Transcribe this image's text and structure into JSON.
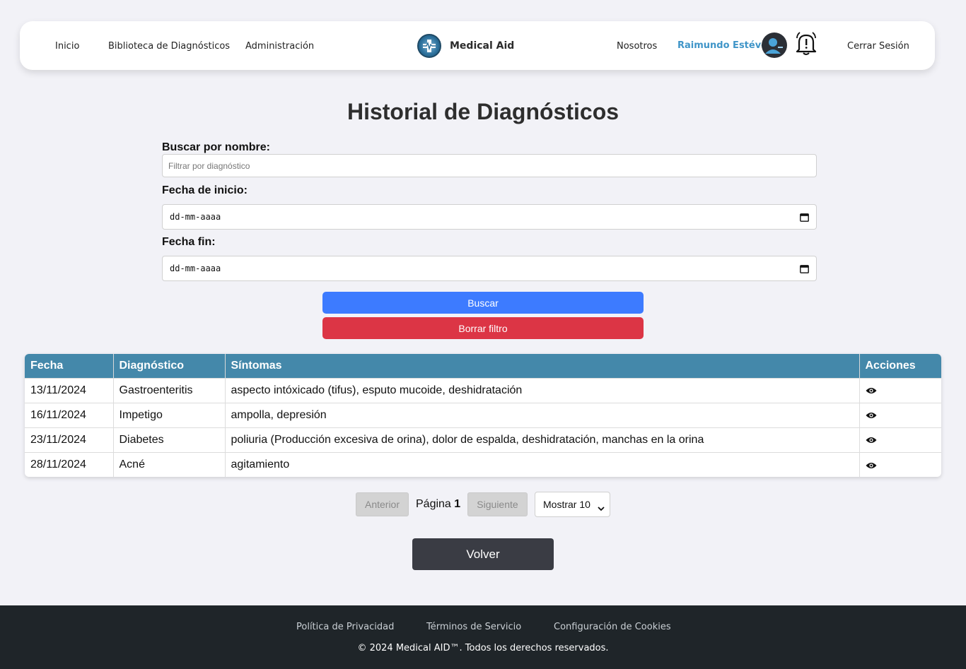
{
  "nav": {
    "links": [
      "Inicio",
      "Biblioteca de Diagnósticos",
      "Administración"
    ],
    "brand": "Medical Aid",
    "about": "Nosotros",
    "user_name": "Raimundo Estévez",
    "logout": "Cerrar Sesión"
  },
  "page": {
    "title": "Historial de Diagnósticos"
  },
  "filters": {
    "name_label": "Buscar por nombre:",
    "name_placeholder": "Filtrar por diagnóstico",
    "start_label": "Fecha de inicio:",
    "start_value": "dd-mm-aaaa",
    "end_label": "Fecha fin:",
    "end_value": "dd-mm-aaaa",
    "search_button": "Buscar",
    "clear_button": "Borrar filtro"
  },
  "table": {
    "headers": [
      "Fecha",
      "Diagnóstico",
      "Síntomas",
      "Acciones"
    ],
    "rows": [
      {
        "date": "13/11/2024",
        "diagnosis": "Gastroenteritis",
        "symptoms": "aspecto intóxicado (tifus), esputo mucoide, deshidratación"
      },
      {
        "date": "16/11/2024",
        "diagnosis": "Impetigo",
        "symptoms": "ampolla, depresión"
      },
      {
        "date": "23/11/2024",
        "diagnosis": "Diabetes",
        "symptoms": "poliuria (Producción excesiva de orina), dolor de espalda, deshidratación, manchas en la orina"
      },
      {
        "date": "28/11/2024",
        "diagnosis": "Acné",
        "symptoms": "agitamiento"
      }
    ]
  },
  "pagination": {
    "prev": "Anterior",
    "page_word": "Página",
    "page_number": "1",
    "next": "Siguiente",
    "page_size": "Mostrar 10"
  },
  "back_button": "Volver",
  "footer": {
    "links": [
      "Política de Privacidad",
      "Términos de Servicio",
      "Configuración de Cookies"
    ],
    "copyright": "© 2024 Medical AID™. Todos los derechos reservados."
  },
  "colors": {
    "primary": "#3d7bff",
    "danger": "#dc3545",
    "table_header": "#4488aa",
    "footer": "#1f2529",
    "user_name": "#3f95c8"
  }
}
